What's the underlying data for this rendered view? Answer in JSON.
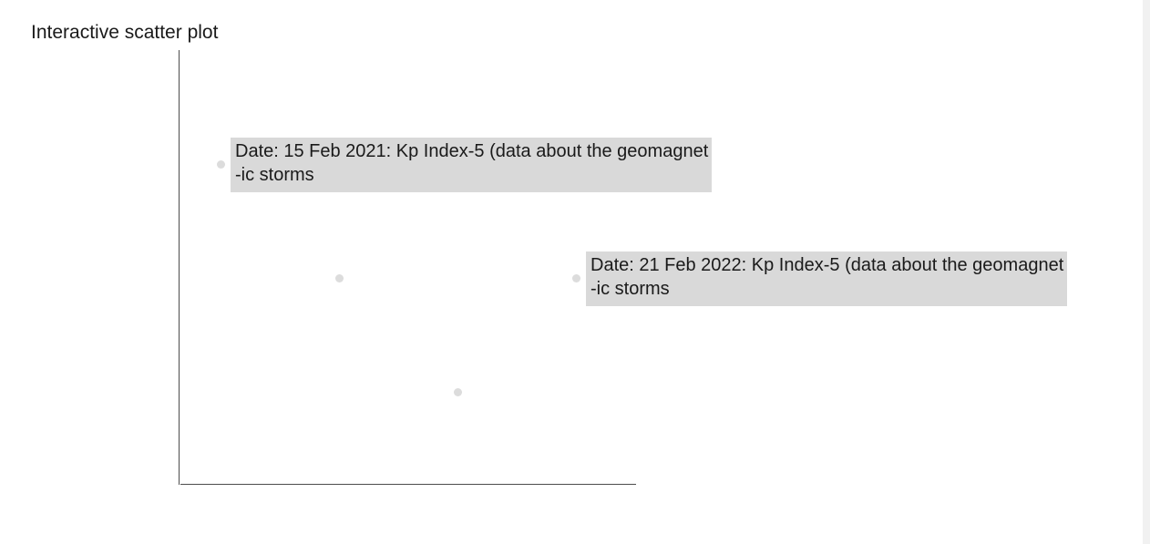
{
  "page": {
    "title": "Interactive scatter plot"
  },
  "chart_data": {
    "type": "scatter",
    "title": "Interactive scatter plot",
    "xlabel": "",
    "ylabel": "",
    "grid": false,
    "points": [
      {
        "x": 1,
        "y": 6
      },
      {
        "x": 2,
        "y": 5
      },
      {
        "x": 3,
        "y": 4
      },
      {
        "x": 4,
        "y": 5
      }
    ],
    "tooltips": [
      {
        "point": 0,
        "text": "Date: 15 Feb 2021: Kp Index-5 (data about the geomagnet\n-ic storms"
      },
      {
        "point": 3,
        "text": "Date: 21 Feb 2022: Kp Index-5 (data about the geomagnet\n-ic storms"
      }
    ],
    "colors": {
      "point": "#dcdcdc",
      "tooltip_bg": "#d9d9d9",
      "axis": "#4d4d4d"
    }
  }
}
